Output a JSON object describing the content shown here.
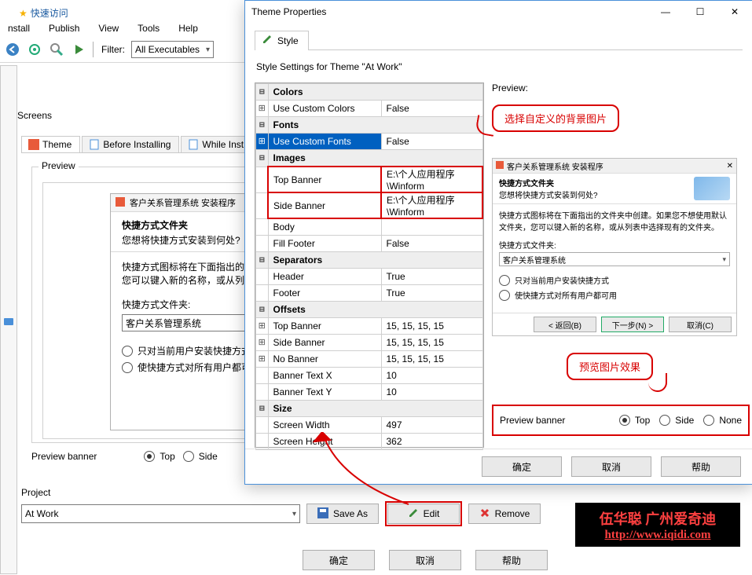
{
  "menubar": {
    "install": "nstall",
    "publish": "Publish",
    "view": "View",
    "tools": "Tools",
    "help": "Help"
  },
  "toolbar": {
    "filter_label": "Filter:",
    "filter_value": "All Executables"
  },
  "quick_access": "快速访问",
  "sidebar": {
    "screens": "Screens"
  },
  "tabs": {
    "theme": "Theme",
    "before": "Before Installing",
    "while": "While Inst"
  },
  "preview_group": {
    "legend": "Preview"
  },
  "wizard": {
    "titlebar": "客户关系管理系统 安装程序",
    "heading": "快捷方式文件夹",
    "subheading": "您想将快捷方式安装到何处?",
    "desc": "快捷方式图标将在下面指出的文件夹中创建。如果您不想使用默认文件夹，您可以键入新的名称，或从列表中选择现有的文件夹。",
    "folder_label": "快捷方式文件夹:",
    "folder_value": "客户关系管理系统",
    "radio1": "只对当前用户安装快捷方式",
    "radio2": "使快捷方式对所有用户都可用"
  },
  "preview_banner": {
    "label": "Preview banner",
    "top": "Top",
    "side": "Side",
    "none": "None"
  },
  "project": {
    "label": "Project",
    "value": "At Work",
    "save_as": "Save As",
    "edit": "Edit",
    "remove": "Remove"
  },
  "bottom": {
    "ok": "确定",
    "cancel": "取消",
    "help": "帮助"
  },
  "dialog": {
    "title": "Theme Properties",
    "tab": "Style",
    "settings_for": "Style Settings for Theme \"At Work\"",
    "preview": "Preview:",
    "callout1": "选择自定义的背景图片",
    "callout2": "预览图片效果",
    "grid": {
      "colors": {
        "cat": "Colors",
        "use_custom": "Use Custom Colors",
        "use_custom_v": "False"
      },
      "fonts": {
        "cat": "Fonts",
        "use_custom": "Use Custom Fonts",
        "use_custom_v": "False"
      },
      "images": {
        "cat": "Images",
        "top": "Top Banner",
        "top_v": "E:\\个人应用程序\\Winform",
        "side": "Side Banner",
        "side_v": "E:\\个人应用程序\\Winform",
        "body": "Body",
        "fill": "Fill Footer",
        "fill_v": "False"
      },
      "separators": {
        "cat": "Separators",
        "header": "Header",
        "header_v": "True",
        "footer": "Footer",
        "footer_v": "True"
      },
      "offsets": {
        "cat": "Offsets",
        "top": "Top Banner",
        "top_v": "15, 15, 15, 15",
        "side": "Side Banner",
        "side_v": "15, 15, 15, 15",
        "no": "No Banner",
        "no_v": "15, 15, 15, 15",
        "btx": "Banner Text X",
        "btx_v": "10",
        "bty": "Banner Text Y",
        "bty_v": "10"
      },
      "size": {
        "cat": "Size",
        "w": "Screen Width",
        "w_v": "497",
        "h": "Screen Height",
        "h_v": "362"
      }
    },
    "preview_wizard": {
      "titlebar": "客户关系管理系统 安装程序",
      "heading": "快捷方式文件夹",
      "subheading": "您想将快捷方式安装到何处?",
      "desc": "快捷方式图标将在下面指出的文件夹中创建。如果您不想使用默认文件夹，您可以键入新的名称，或从列表中选择现有的文件夹。",
      "folder_label": "快捷方式文件夹:",
      "folder_value": "客户关系管理系统",
      "radio1": "只对当前用户安装快捷方式",
      "radio2": "使快捷方式对所有用户都可用",
      "back": "< 返回(B)",
      "next": "下一步(N) >",
      "cancel": "取消(C)"
    },
    "preview_banner": {
      "label": "Preview banner",
      "top": "Top",
      "side": "Side",
      "none": "None"
    },
    "footer": {
      "ok": "确定",
      "cancel": "取消",
      "help": "帮助"
    }
  },
  "watermark": {
    "l1": "伍华聪 广州爱奇迪",
    "l2": "http://www.iqidi.com"
  }
}
